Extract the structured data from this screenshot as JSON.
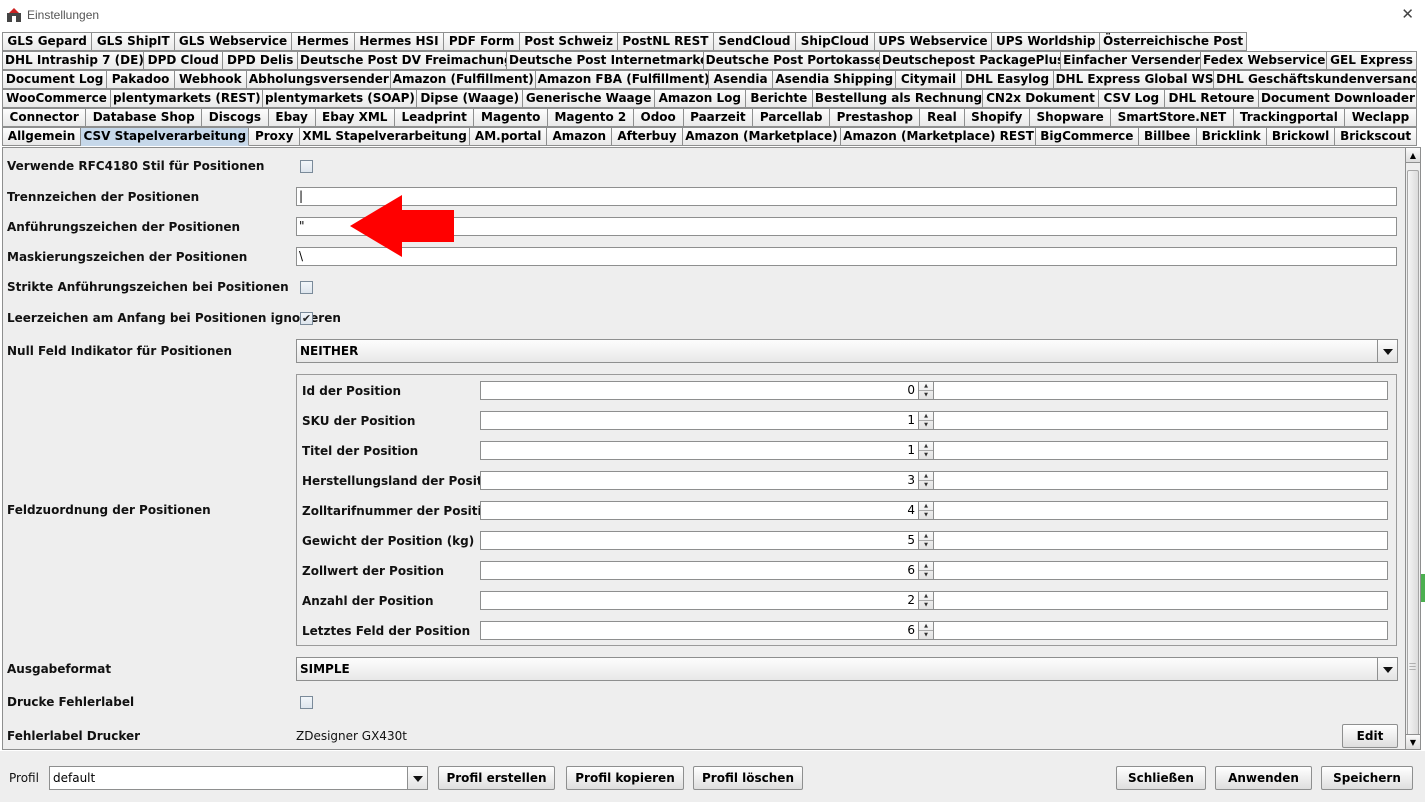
{
  "window": {
    "title": "Einstellungen"
  },
  "tab_rows": [
    [
      "GLS Gepard",
      "GLS ShipIT",
      "GLS Webservice",
      "Hermes",
      "Hermes HSI",
      "PDF Form",
      "Post Schweiz",
      "PostNL REST",
      "SendCloud",
      "ShipCloud",
      "UPS Webservice",
      "UPS Worldship",
      "Österreichische Post"
    ],
    [
      "DHL Intraship 7 (DE)",
      "DPD Cloud",
      "DPD Delis",
      "Deutsche Post DV Freimachung",
      "Deutsche Post Internetmarke",
      "Deutsche Post Portokasse",
      "Deutschepost PackagePlus",
      "Einfacher Versender",
      "Fedex Webservice",
      "GEL Express"
    ],
    [
      "Document Log",
      "Pakadoo",
      "Webhook",
      "Abholungsversender",
      "Amazon (Fulfillment)",
      "Amazon FBA (Fulfillment)",
      "Asendia",
      "Asendia Shipping",
      "Citymail",
      "DHL Easylog",
      "DHL Express Global WS",
      "DHL Geschäftskundenversand"
    ],
    [
      "WooCommerce",
      "plentymarkets (REST)",
      "plentymarkets (SOAP)",
      "Dipse (Waage)",
      "Generische Waage",
      "Amazon Log",
      "Berichte",
      "Bestellung als Rechnung",
      "CN2x Dokument",
      "CSV Log",
      "DHL Retoure",
      "Document Downloader"
    ],
    [
      "Connector",
      "Database Shop",
      "Discogs",
      "Ebay",
      "Ebay XML",
      "Leadprint",
      "Magento",
      "Magento 2",
      "Odoo",
      "Paarzeit",
      "Parcellab",
      "Prestashop",
      "Real",
      "Shopify",
      "Shopware",
      "SmartStore.NET",
      "Trackingportal",
      "Weclapp"
    ],
    [
      "Allgemein",
      "CSV Stapelverarbeitung",
      "Proxy",
      "XML Stapelverarbeitung",
      "AM.portal",
      "Amazon",
      "Afterbuy",
      "Amazon (Marketplace)",
      "Amazon (Marketplace) REST",
      "BigCommerce",
      "Billbee",
      "Bricklink",
      "Brickowl",
      "Brickscout"
    ]
  ],
  "active_tab": "CSV Stapelverarbeitung",
  "settings": {
    "rfc4180_label": "Verwende RFC4180 Stil für Positionen",
    "rfc4180_checked": "",
    "separator_label": "Trennzeichen der Positionen",
    "separator_value": "|",
    "quote_label": "Anführungszeichen der Positionen",
    "quote_value": "\"",
    "escape_label": "Maskierungszeichen der Positionen",
    "escape_value": "\\",
    "strict_quotes_label": "Strikte Anführungszeichen bei Positionen",
    "strict_quotes_checked": "",
    "ignore_spaces_label": "Leerzeichen am Anfang bei Positionen ignorieren",
    "ignore_spaces_checked": "✔",
    "null_indicator_label": "Null Feld Indikator für Positionen",
    "null_indicator_value": "NEITHER",
    "field_mapping_label": "Feldzuordnung der Positionen",
    "field_mapping": [
      {
        "label": "Id der Position",
        "value": "0"
      },
      {
        "label": "SKU der Position",
        "value": "1"
      },
      {
        "label": "Titel der Position",
        "value": "1"
      },
      {
        "label": "Herstellungsland der Position",
        "value": "3"
      },
      {
        "label": "Zolltarifnummer der Position",
        "value": "4"
      },
      {
        "label": "Gewicht der Position (kg)",
        "value": "5"
      },
      {
        "label": "Zollwert der Position",
        "value": "6"
      },
      {
        "label": "Anzahl der Position",
        "value": "2"
      },
      {
        "label": "Letztes Feld der Position",
        "value": "6"
      }
    ],
    "output_format_label": "Ausgabeformat",
    "output_format_value": "SIMPLE",
    "print_error_label": "Drucke Fehlerlabel",
    "print_error_checked": "",
    "error_printer_label": "Fehlerlabel Drucker",
    "error_printer_value": "ZDesigner GX430t",
    "edit_button": "Edit"
  },
  "footer": {
    "profile_label": "Profil",
    "profile_value": "default",
    "create_button": "Profil erstellen",
    "copy_button": "Profil kopieren",
    "delete_button": "Profil löschen",
    "close_button": "Schließen",
    "apply_button": "Anwenden",
    "save_button": "Speichern"
  },
  "colors": {
    "active_tab": "#c6d8ea",
    "panel_bg": "#eeeeee",
    "annotation_arrow": "#ff0000"
  }
}
